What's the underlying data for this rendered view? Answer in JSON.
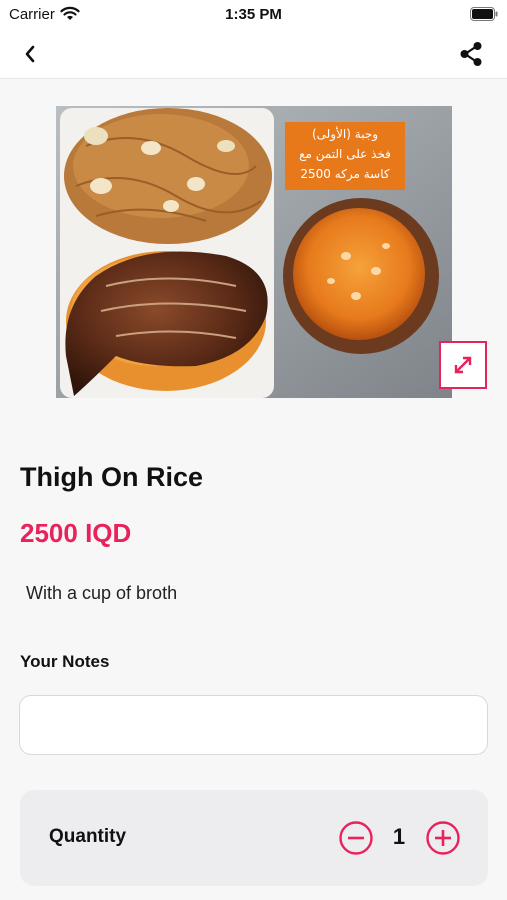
{
  "status_bar": {
    "carrier": "Carrier",
    "time": "1:35 PM",
    "icons": [
      "wifi-icon",
      "battery-icon"
    ]
  },
  "nav": {
    "back_icon": "chevron-left-icon",
    "share_icon": "share-icon"
  },
  "photo": {
    "overlay_line1": "وجبة (الأولى)",
    "overlay_line2": "فخذ على التمن مع",
    "overlay_line3": "كاسة مركه 2500",
    "expand_icon": "expand-arrows-icon"
  },
  "item": {
    "title": "Thigh On Rice",
    "price": "2500 IQD",
    "description": "With a cup of broth"
  },
  "notes": {
    "label": "Your Notes",
    "value": "",
    "placeholder": ""
  },
  "quantity": {
    "label": "Quantity",
    "value": "1"
  },
  "colors": {
    "accent": "#e8225a",
    "background": "#f7f7f8",
    "card": "#ededf0"
  }
}
